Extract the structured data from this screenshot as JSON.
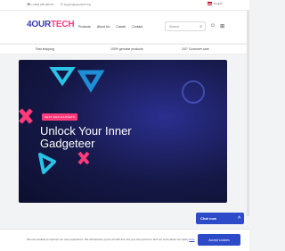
{
  "topbar": {
    "phone": "(+351) 220 309 00",
    "email": "support@yourtech.tiny",
    "language": "English"
  },
  "header": {
    "logo_main": "4OUR",
    "logo_accent": "TECH",
    "nav": [
      "Products",
      "About Us",
      "Cancel",
      "Contact"
    ],
    "search_placeholder": "Search"
  },
  "benefits": [
    "Fast shipping",
    "100% genuine products",
    "24/7 Customer care"
  ],
  "hero": {
    "badge": "NEXT-GEN GADGETS",
    "headline": "Unlock Your Inner Gadgeteer"
  },
  "chat": {
    "label": "Chat now"
  },
  "cookie": {
    "message": "We use cookies to improve our user experience. We will assume you're ok with this, but you can opt-out or find out more about our policy",
    "link": "here",
    "accept_label": "Accept cookies"
  },
  "colors": {
    "brand": "#3b3fb8",
    "accent": "#ff3a7a",
    "primary_button": "#2d4bc8",
    "hero_bg": "#151846"
  }
}
